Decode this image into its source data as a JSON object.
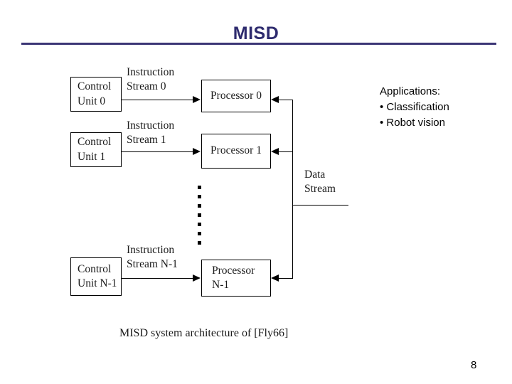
{
  "slide": {
    "title": "MISD",
    "page_number": "8",
    "caption": "MISD system architecture of [Fly66]",
    "title_color": "#2e2b6e",
    "rule_color": "#3b3575",
    "line_color": "#000000",
    "background": "#ffffff"
  },
  "diagram": {
    "control_units": [
      {
        "line1": "Control",
        "line2": "Unit 0"
      },
      {
        "line1": "Control",
        "line2": "Unit 1"
      },
      {
        "line1": "Control",
        "line2": "Unit N-1"
      }
    ],
    "instruction_streams": [
      {
        "line1": "Instruction",
        "line2": "Stream 0"
      },
      {
        "line1": "Instruction",
        "line2": "Stream 1"
      },
      {
        "line1": "Instruction",
        "line2": "Stream N-1"
      }
    ],
    "processors": [
      {
        "line1": "Processor 0",
        "line2": ""
      },
      {
        "line1": "Processor 1",
        "line2": ""
      },
      {
        "line1": "Processor",
        "line2": "N-1"
      }
    ],
    "data_stream": {
      "line1": "Data",
      "line2": "Stream"
    },
    "ellipsis_dot_count": 7
  },
  "applications": {
    "heading": "Applications:",
    "items": [
      "• Classification",
      "• Robot vision"
    ]
  }
}
